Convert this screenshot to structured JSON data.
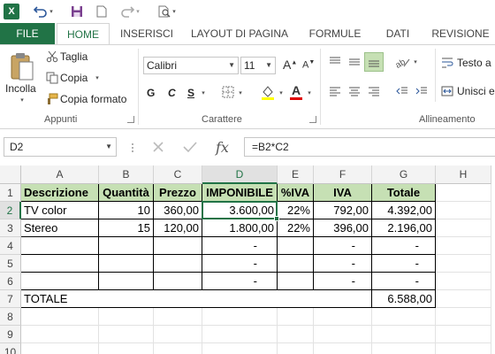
{
  "app": {
    "logo": "X"
  },
  "tabs": [
    "FILE",
    "HOME",
    "INSERISCI",
    "LAYOUT DI PAGINA",
    "FORMULE",
    "DATI",
    "REVISIONE"
  ],
  "ribbon": {
    "clipboard": {
      "paste": "Incolla",
      "cut": "Taglia",
      "copy": "Copia",
      "format_painter": "Copia formato",
      "label": "Appunti"
    },
    "font": {
      "name": "Calibri",
      "size": "11",
      "bold": "G",
      "italic": "C",
      "underline": "S",
      "label": "Carattere",
      "grow": "A",
      "shrink": "A",
      "color_letter": "A"
    },
    "alignment": {
      "wrap": "Testo a",
      "merge": "Unisci e",
      "label": "Allineamento"
    }
  },
  "formula_bar": {
    "name_box": "D2",
    "fx": "fx",
    "formula": "=B2*C2"
  },
  "sheet": {
    "columns": [
      "A",
      "B",
      "C",
      "D",
      "E",
      "F",
      "G",
      "H"
    ],
    "rows": [
      "1",
      "2",
      "3",
      "4",
      "5",
      "6",
      "7",
      "8",
      "9",
      "10"
    ],
    "header": [
      "Descrizione",
      "Quantità",
      "Prezzo",
      "IMPONIBILE",
      "%IVA",
      "IVA",
      "Totale"
    ],
    "data": [
      [
        "TV color",
        "10",
        "360,00",
        "3.600,00",
        "22%",
        "792,00",
        "4.392,00"
      ],
      [
        "Stereo",
        "15",
        "120,00",
        "1.800,00",
        "22%",
        "396,00",
        "2.196,00"
      ],
      [
        "",
        "",
        "",
        "-",
        "",
        "-",
        "-"
      ],
      [
        "",
        "",
        "",
        "-",
        "",
        "-",
        "-"
      ],
      [
        "",
        "",
        "",
        "-",
        "",
        "-",
        "-"
      ]
    ],
    "total": {
      "label": "TOTALE",
      "value": "6.588,00"
    }
  },
  "colors": {
    "accent": "#217346",
    "header_fill": "#c6e0b4"
  }
}
